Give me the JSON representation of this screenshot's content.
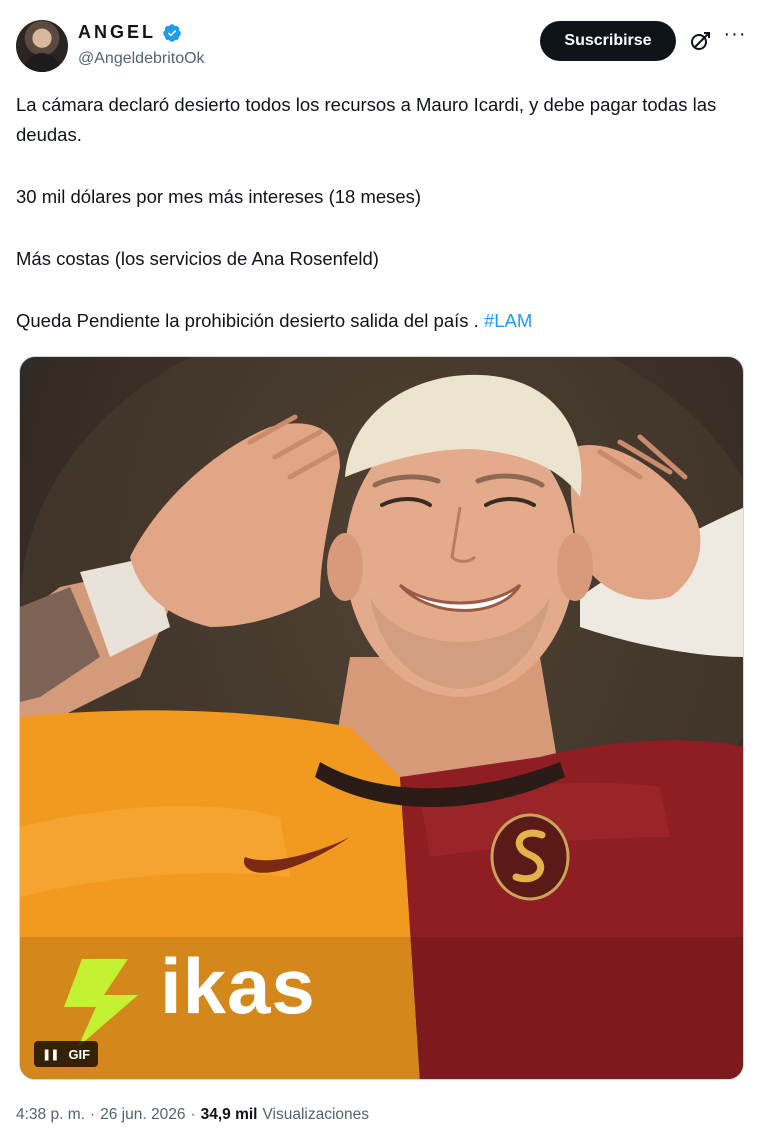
{
  "author": {
    "display_name": "ANGEL",
    "handle": "@AngeldebritoOk",
    "verified": true
  },
  "header": {
    "subscribe_label": "Suscribirse",
    "grok_icon": "grok-icon",
    "more_icon": "more-icon",
    "more_glyph": "···"
  },
  "tweet": {
    "line1": "La cámara declaró desierto todos los recursos a Mauro Icardi, y debe pagar todas las deudas.",
    "line2": "30 mil dólares por mes más intereses (18 meses)",
    "line3": "Más costas (los servicios de Ana Rosenfeld)",
    "line4": "Queda Pendiente la prohibición desierto salida del país . ",
    "hashtag": "#LAM"
  },
  "media": {
    "type": "GIF",
    "gif_label": "GIF",
    "pause_glyph": "❚❚",
    "watermark": "ikas",
    "colors": {
      "jersey_yellow": "#f29a1f",
      "jersey_red": "#8e1e22",
      "logo_green": "#c4f233"
    }
  },
  "meta": {
    "time": "4:38 p. m.",
    "separator": "·",
    "date": "26 jun. 2026",
    "views_count": "34,9 mil",
    "views_label": "Visualizaciones"
  },
  "colors": {
    "text_primary": "#0f1419",
    "text_secondary": "#536471",
    "link": "#1d9bf0",
    "verified": "#1d9bf0"
  }
}
